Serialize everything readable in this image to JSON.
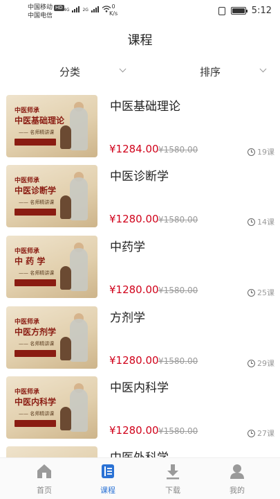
{
  "status_bar": {
    "carrier1": "中国移动",
    "carrier1_badge": "HD",
    "carrier2": "中国电信",
    "net1": "4G",
    "net2": "2G",
    "speed_value": "0",
    "speed_unit": "K/s",
    "time": "5:12"
  },
  "header": {
    "title": "课程"
  },
  "filters": {
    "category": "分类",
    "sort": "排序"
  },
  "courses": [
    {
      "thumb_tag": "中医师承",
      "thumb_title": "中医基础理论",
      "thumb_sub": "—— 名师精讲课",
      "title": "中医基础理论",
      "price": "¥1284.00",
      "original_price": "¥1580.00",
      "lessons": "19课"
    },
    {
      "thumb_tag": "中医师承",
      "thumb_title": "中医诊断学",
      "thumb_sub": "—— 名师精讲课",
      "title": "中医诊断学",
      "price": "¥1280.00",
      "original_price": "¥1580.00",
      "lessons": "14课"
    },
    {
      "thumb_tag": "中医师承",
      "thumb_title": "中 药 学",
      "thumb_sub": "—— 名师精讲课",
      "title": "中药学",
      "price": "¥1280.00",
      "original_price": "¥1580.00",
      "lessons": "25课"
    },
    {
      "thumb_tag": "中医师承",
      "thumb_title": "中医方剂学",
      "thumb_sub": "—— 名师精讲课",
      "title": "方剂学",
      "price": "¥1280.00",
      "original_price": "¥1580.00",
      "lessons": "29课"
    },
    {
      "thumb_tag": "中医师承",
      "thumb_title": "中医内科学",
      "thumb_sub": "—— 名师精讲课",
      "title": "中医内科学",
      "price": "¥1280.00",
      "original_price": "¥1580.00",
      "lessons": "27课"
    },
    {
      "thumb_tag": "",
      "thumb_title": "",
      "thumb_sub": "",
      "title": "中医外科学",
      "price": "",
      "original_price": "",
      "lessons": ""
    }
  ],
  "tabbar": {
    "home": "首页",
    "course": "课程",
    "download": "下载",
    "me": "我的",
    "active_color": "#2a72d5",
    "inactive_color": "#888888"
  },
  "colors": {
    "price": "#d0021b",
    "accent": "#2a72d5"
  }
}
